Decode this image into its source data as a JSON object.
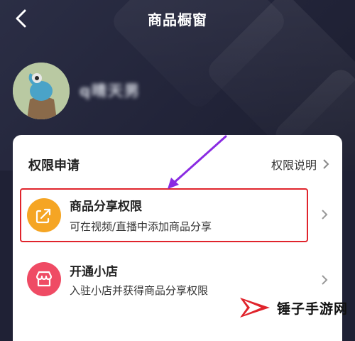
{
  "header": {
    "title": "商品橱窗",
    "back_icon": "chevron-left-icon"
  },
  "profile": {
    "username": "q晴天男"
  },
  "permissions": {
    "section_title": "权限申请",
    "explain_link": "权限说明",
    "items": [
      {
        "title": "商品分享权限",
        "description": "可在视频/直播中添加商品分享",
        "icon": "share-arrow-icon",
        "icon_color": "#f5a524",
        "highlighted": true
      },
      {
        "title": "开通小店",
        "description": "入驻小店并获得商品分享权限",
        "icon": "store-icon",
        "icon_color": "#ef4b64",
        "highlighted": false
      }
    ]
  },
  "annotation": {
    "arrow_color": "#8a2be2",
    "highlight_color": "#e0242c"
  },
  "watermark": {
    "text": "锤子手游网",
    "accent": "#e0242c"
  }
}
